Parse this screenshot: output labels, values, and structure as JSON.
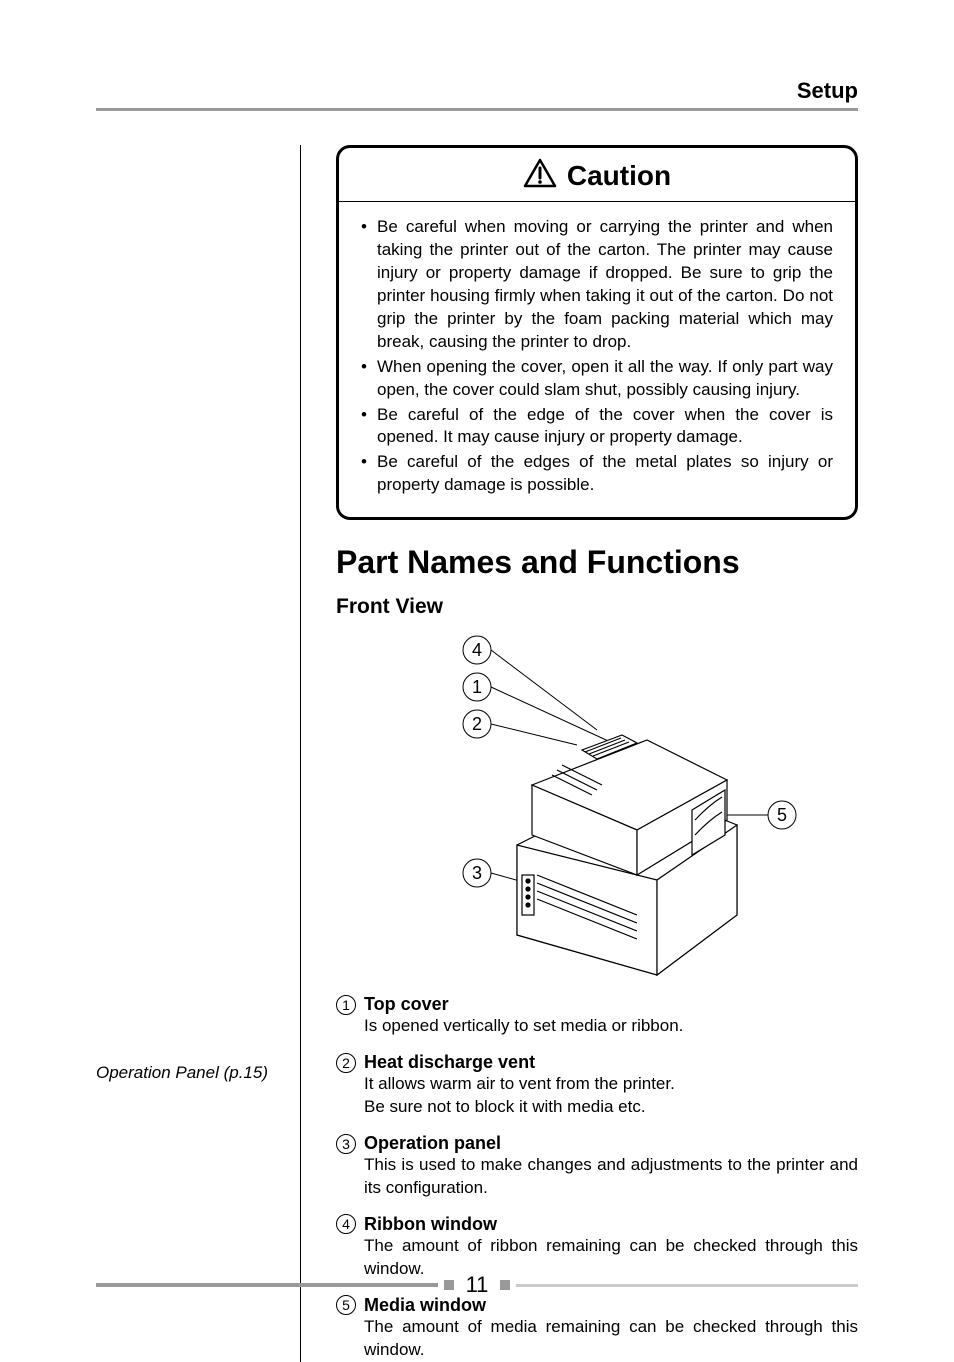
{
  "header": {
    "title": "Setup"
  },
  "sidebar": {
    "note": "Operation Panel (p.15)"
  },
  "caution": {
    "title": "Caution",
    "items": [
      "Be careful when moving or carrying the printer and when taking the printer out of the carton. The printer may cause injury or property damage if dropped. Be sure to grip the printer housing firmly when taking it out of the carton. Do not grip the printer by the foam packing material which may break, causing the printer to drop.",
      "When opening the cover, open it all the way. If only part way open, the cover could slam shut, possibly causing injury.",
      "Be careful of the edge of the cover when the cover is opened. It may cause injury or property damage.",
      "Be careful of the edges of the metal plates so injury or property damage is possible."
    ]
  },
  "section": {
    "heading": "Part Names and Functions"
  },
  "front_view": {
    "heading": "Front View",
    "callouts": [
      "4",
      "1",
      "2",
      "3",
      "5"
    ]
  },
  "parts": [
    {
      "num": "1",
      "title": "Top cover",
      "desc": "Is opened vertically to set media or ribbon."
    },
    {
      "num": "2",
      "title": "Heat discharge vent",
      "desc": "It allows warm air to vent from the printer.\nBe sure not to block it with media etc."
    },
    {
      "num": "3",
      "title": "Operation panel",
      "desc": "This is used to make changes and adjustments to the printer and its configuration."
    },
    {
      "num": "4",
      "title": "Ribbon window",
      "desc": "The amount of ribbon remaining can be checked through this window."
    },
    {
      "num": "5",
      "title": "Media window",
      "desc": "The amount of media remaining can be checked through this window."
    }
  ],
  "footer": {
    "page": "11"
  }
}
